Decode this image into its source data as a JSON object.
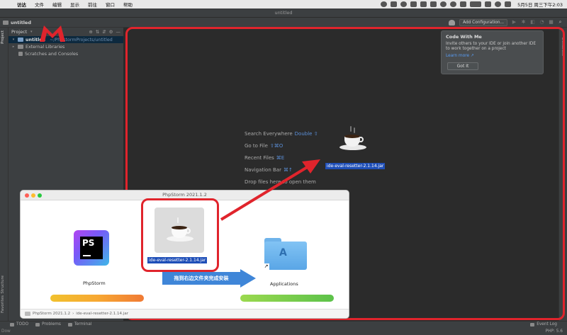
{
  "menubar": {
    "app": "访达",
    "items": [
      "文件",
      "编辑",
      "显示",
      "前往",
      "窗口",
      "帮助"
    ],
    "clock": "5月5日 周三下午2:03"
  },
  "window": {
    "title": "untitled"
  },
  "toolbar": {
    "project_name": "untitled",
    "add_configuration": "Add Configuration..."
  },
  "tool_windows": {
    "left": [
      "Project",
      "Structure",
      "Favorites"
    ],
    "right": [
      "Database"
    ]
  },
  "project_panel": {
    "header": "Project",
    "tree": [
      {
        "label": "untitled",
        "path": "~/PhpstormProjects/untitled",
        "selected": true
      },
      {
        "label": "External Libraries"
      },
      {
        "label": "Scratches and Consoles"
      }
    ]
  },
  "editor_hints": [
    {
      "label": "Search Everywhere",
      "key": "Double ⇧"
    },
    {
      "label": "Go to File",
      "key": "⇧⌘O"
    },
    {
      "label": "Recent Files",
      "key": "⌘E"
    },
    {
      "label": "Navigation Bar",
      "key": "⌘↑"
    },
    {
      "label": "Drop files here to open them",
      "key": ""
    }
  ],
  "code_with_me": {
    "title": "Code With Me",
    "description": "Invite others to your IDE or join another IDE to work together on a project",
    "link": "Learn more ↗",
    "button": "Got It"
  },
  "jar_file": "ide-eval-resetter-2.1.14.jar",
  "installer": {
    "title": "PhpStorm 2021.1.2",
    "app_label": "PhpStorm",
    "apps_label": "Applications",
    "jar_label": "ide-eval-resetter-2.1.14.jar",
    "instruction": "拖到右边文件夹完成安装",
    "status_path": [
      "PhpStorm 2021.1.2",
      "ide-eval-resetter-2.1.14.jar"
    ],
    "colors": {
      "orange_bar": "#f7a832",
      "green_bar": "#5cc24a"
    }
  },
  "bottom_bar": {
    "tabs": [
      "TODO",
      "Problems",
      "Terminal"
    ],
    "event_log": "Event Log",
    "php_version": "PHP: 5.6",
    "left_text": "Dow"
  },
  "accent": {
    "annotation_red": "#e0242c",
    "selection_blue": "#1f4fb8"
  }
}
